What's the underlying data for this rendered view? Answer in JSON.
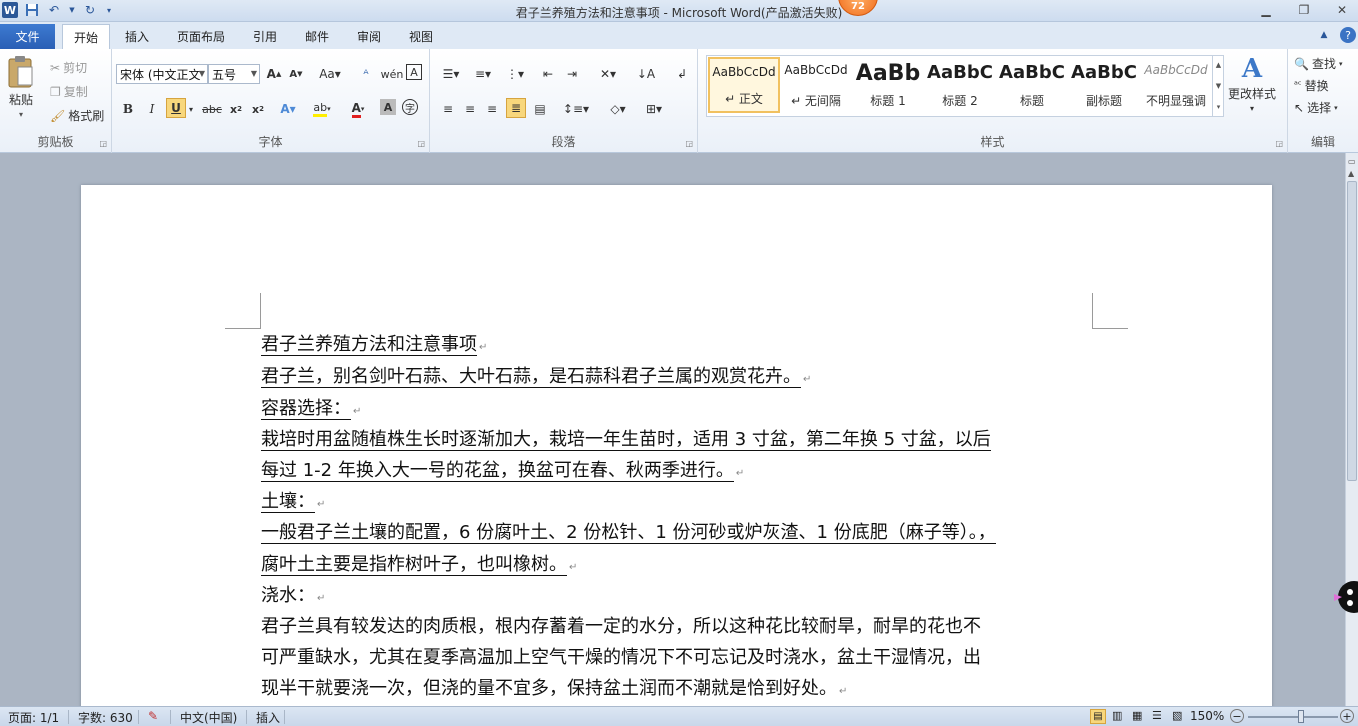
{
  "window": {
    "title": "君子兰养殖方法和注意事项  -  Microsoft Word(产品激活失败)",
    "notification_count": "72"
  },
  "tabs": {
    "file": "文件",
    "items": [
      "开始",
      "插入",
      "页面布局",
      "引用",
      "邮件",
      "审阅",
      "视图"
    ],
    "active": "开始"
  },
  "ribbon": {
    "clipboard": {
      "paste": "粘贴",
      "cut": "剪切",
      "copy": "复制",
      "format_painter": "格式刷",
      "label": "剪贴板"
    },
    "font": {
      "font_name": "宋体 (中文正文)",
      "font_size": "五号",
      "label": "字体"
    },
    "paragraph": {
      "label": "段落"
    },
    "styles": {
      "items": [
        {
          "preview": "AaBbCcDd",
          "name": "↵ 正文"
        },
        {
          "preview": "AaBbCcDd",
          "name": "↵ 无间隔"
        },
        {
          "preview": "AaBb",
          "name": "标题 1"
        },
        {
          "preview": "AaBbC",
          "name": "标题 2"
        },
        {
          "preview": "AaBbC",
          "name": "标题"
        },
        {
          "preview": "AaBbC",
          "name": "副标题"
        },
        {
          "preview": "AaBbCcDd",
          "name": "不明显强调"
        }
      ],
      "change_styles": "更改样式",
      "label": "样式"
    },
    "editing": {
      "find": "查找",
      "replace": "替换",
      "select": "选择",
      "label": "编辑"
    }
  },
  "document": {
    "lines": [
      "君子兰养殖方法和注意事项",
      "君子兰，别名剑叶石蒜、大叶石蒜，是石蒜科君子兰属的观赏花卉。",
      "容器选择：",
      "栽培时用盆随植株生长时逐渐加大，栽培一年生苗时，适用 3 寸盆，第二年换 5 寸盆，以后",
      "每过 1-2 年换入大一号的花盆，换盆可在春、秋两季进行。",
      "土壤：",
      "一般君子兰土壤的配置，6 份腐叶土、2 份松针、1 份河砂或炉灰渣、1 份底肥（麻子等）。，",
      "腐叶土主要是指柞树叶子，也叫橡树。",
      "浇水：",
      "君子兰具有较发达的肉质根，根内存蓄着一定的水分，所以这种花比较耐旱，耐旱的花也不",
      "可严重缺水，尤其在夏季高温加上空气干燥的情况下不可忘记及时浇水，盆土干湿情况，出",
      "现半干就要浇一次，但浇的量不宜多，保持盆土润而不潮就是恰到好处。"
    ]
  },
  "statusbar": {
    "page": "页面: 1/1",
    "words": "字数: 630",
    "language": "中文(中国)",
    "mode": "插入",
    "zoom": "150%"
  }
}
